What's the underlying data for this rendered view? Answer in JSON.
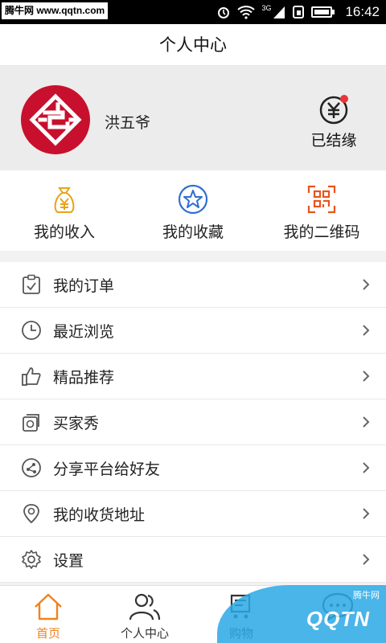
{
  "statusbar": {
    "watermark": "腾牛网 www.qqtn.com",
    "network": "3G",
    "time": "16:42"
  },
  "header": {
    "title": "个人中心"
  },
  "profile": {
    "username": "洪五爷",
    "fate_label": "已结缘",
    "fate_icon": "yuan-coin-icon",
    "badge_color": "#e8353a"
  },
  "quick_actions": [
    {
      "label": "我的收入",
      "icon": "money-bag-icon",
      "color": "#e8a317"
    },
    {
      "label": "我的收藏",
      "icon": "star-icon",
      "color": "#2f6fd0"
    },
    {
      "label": "我的二维码",
      "icon": "qr-code-icon",
      "color": "#e8541e"
    }
  ],
  "menu": [
    {
      "label": "我的订单",
      "icon": "clipboard-check-icon"
    },
    {
      "label": "最近浏览",
      "icon": "clock-icon"
    },
    {
      "label": "精品推荐",
      "icon": "thumbs-up-icon"
    },
    {
      "label": "买家秀",
      "icon": "photo-stack-icon"
    },
    {
      "label": "分享平台给好友",
      "icon": "share-icon"
    },
    {
      "label": "我的收货地址",
      "icon": "location-pin-icon"
    },
    {
      "label": "设置",
      "icon": "gear-icon"
    }
  ],
  "bottom_nav": [
    {
      "label": "首页",
      "icon": "home-icon",
      "active": true
    },
    {
      "label": "个人中心",
      "icon": "people-icon",
      "active": false
    },
    {
      "label": "购物",
      "icon": "cart-icon",
      "active": false
    },
    {
      "label": "",
      "icon": "chat-bubble-icon",
      "active": false
    }
  ],
  "watermark": {
    "brand": "QQTN",
    "sub": "腾牛网"
  },
  "colors": {
    "accent": "#f0821e",
    "profile_bg": "#ececec",
    "avatar_red": "#c8102e"
  }
}
